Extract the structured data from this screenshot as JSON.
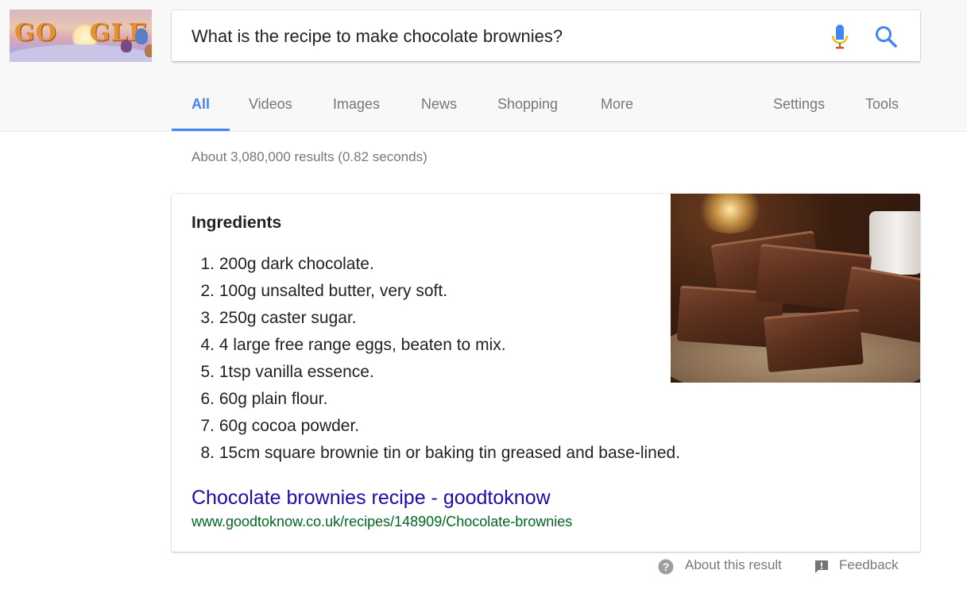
{
  "logo": {
    "text_left": "GO",
    "text_right": "GLE"
  },
  "search": {
    "query": "What is the recipe to make chocolate brownies?",
    "mic_icon": "microphone-icon",
    "search_icon": "search-icon"
  },
  "tabs": {
    "left": [
      {
        "label": "All",
        "active": true
      },
      {
        "label": "Videos"
      },
      {
        "label": "Images"
      },
      {
        "label": "News"
      },
      {
        "label": "Shopping"
      },
      {
        "label": "More"
      }
    ],
    "right": [
      {
        "label": "Settings"
      },
      {
        "label": "Tools"
      }
    ],
    "active_color": "#4285f4"
  },
  "results_stats": "About 3,080,000 results (0.82 seconds)",
  "featured_snippet": {
    "heading": "Ingredients",
    "items": [
      {
        "num": "1.",
        "text": "200g dark chocolate."
      },
      {
        "num": "2.",
        "text": "100g unsalted butter, very soft."
      },
      {
        "num": "3.",
        "text": "250g caster sugar."
      },
      {
        "num": "4.",
        "text": "4 large free range eggs, beaten to mix."
      },
      {
        "num": "5.",
        "text": "1tsp vanilla essence."
      },
      {
        "num": "6.",
        "text": "60g plain flour."
      },
      {
        "num": "7.",
        "text": "60g cocoa powder."
      },
      {
        "num": "8.",
        "text": "15cm square brownie tin or baking tin greased and base-lined."
      }
    ],
    "source_title": "Chocolate brownies recipe - goodtoknow",
    "source_url": "www.goodtoknow.co.uk/recipes/148909/Chocolate-brownies",
    "link_color": "#1a0dab",
    "url_color": "#006621"
  },
  "footer": {
    "about": "About this result",
    "feedback": "Feedback",
    "about_icon": "help-circle-icon",
    "feedback_icon": "feedback-icon"
  }
}
